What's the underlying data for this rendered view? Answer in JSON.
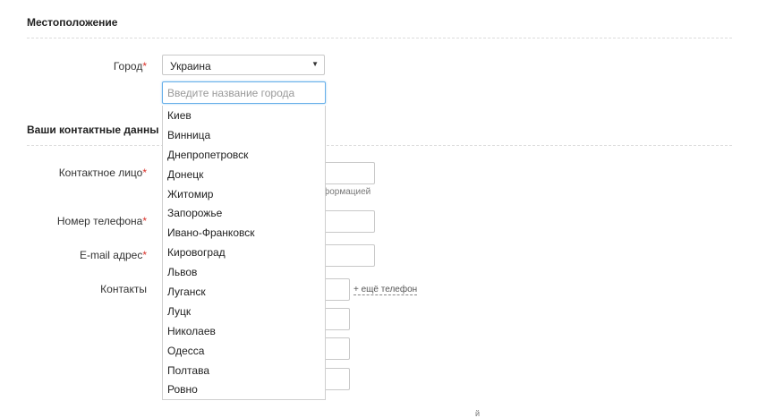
{
  "location": {
    "section_title": "Местоположение",
    "city_label": "Город",
    "required_mark": "*",
    "country_value": "Украина",
    "city_placeholder": "Введите название города",
    "cities": [
      "Киев",
      "Винница",
      "Днепропетровск",
      "Донецк",
      "Житомир",
      "Запорожье",
      "Ивано-Франковск",
      "Кировоград",
      "Львов",
      "Луганск",
      "Луцк",
      "Николаев",
      "Одесса",
      "Полтава",
      "Ровно"
    ]
  },
  "contacts": {
    "section_title": "Ваши контактные данны",
    "contact_person_label": "Контактное лицо",
    "contact_person_hint": "формацией",
    "phone_label": "Номер телефона",
    "email_label": "E-mail адрес",
    "contacts_label": "Контакты",
    "add_phone_link": "+ ещё телефон"
  },
  "stray_mark": "й"
}
